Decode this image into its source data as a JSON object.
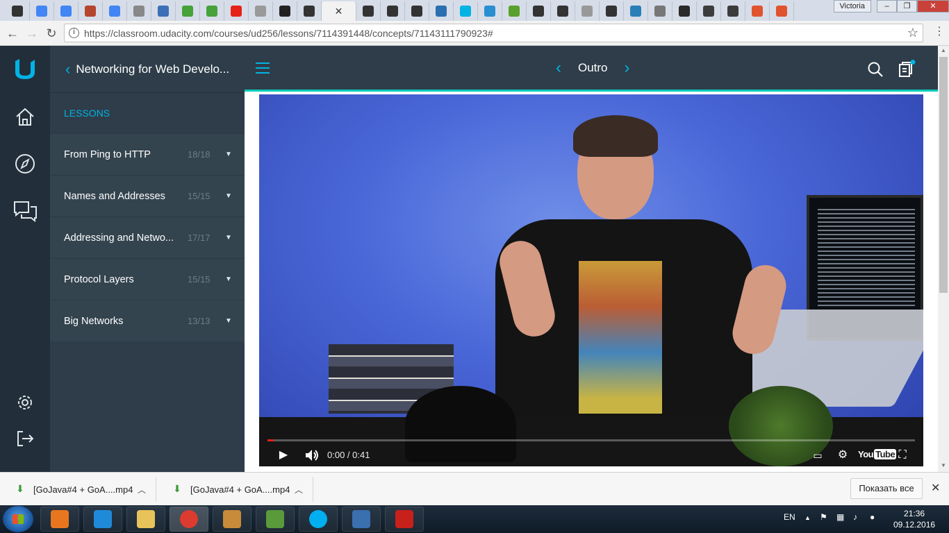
{
  "browser": {
    "tab_favicons": [
      {
        "icon": "github-icon",
        "color": "#333333"
      },
      {
        "icon": "google-icon",
        "color": "#4285f4"
      },
      {
        "icon": "google-icon",
        "color": "#4285f4"
      },
      {
        "icon": "paw-icon",
        "color": "#b5462d"
      },
      {
        "icon": "google-icon",
        "color": "#4285f4"
      },
      {
        "icon": "cart-icon",
        "color": "#888888"
      },
      {
        "icon": "chat-icon",
        "color": "#3b6fb6"
      },
      {
        "icon": "download-icon",
        "color": "#46a23b"
      },
      {
        "icon": "download-icon",
        "color": "#46a23b"
      },
      {
        "icon": "youtube-icon",
        "color": "#e62117"
      },
      {
        "icon": "document-icon",
        "color": "#999999"
      },
      {
        "icon": "ain-icon",
        "color": "#222222"
      },
      {
        "icon": "github-icon",
        "color": "#333333"
      }
    ],
    "tab_favicons_right": [
      {
        "icon": "terminal-icon",
        "color": "#333333"
      },
      {
        "icon": "github-icon",
        "color": "#333333"
      },
      {
        "icon": "github-icon",
        "color": "#333333"
      },
      {
        "icon": "image-icon",
        "color": "#2a6fb0"
      },
      {
        "icon": "udacity-icon",
        "color": "#02b3e4"
      },
      {
        "icon": "v-icon",
        "color": "#2a8fd0"
      },
      {
        "icon": "a-icon",
        "color": "#5aa02c"
      },
      {
        "icon": "github-icon",
        "color": "#333333"
      },
      {
        "icon": "github-icon",
        "color": "#333333"
      },
      {
        "icon": "document-icon",
        "color": "#999999"
      },
      {
        "icon": "github-icon",
        "color": "#333333"
      },
      {
        "icon": "cube-icon",
        "color": "#2a7fb6"
      },
      {
        "icon": "film-icon",
        "color": "#777777"
      },
      {
        "icon": "netping-icon",
        "color": "#2a2a2a"
      },
      {
        "icon": "avatar-icon",
        "color": "#3c3c3c"
      },
      {
        "icon": "avatar-icon",
        "color": "#3c3c3c"
      },
      {
        "icon": "git-icon",
        "color": "#e0532f"
      },
      {
        "icon": "git-icon",
        "color": "#e0532f"
      }
    ],
    "window_user": "Victoria",
    "url": "https://classroom.udacity.com/courses/ud256/lessons/7114391448/concepts/71143111790923#"
  },
  "app": {
    "course_title": "Networking for Web Develo...",
    "lessons_label": "LESSONS",
    "lessons": [
      {
        "name": "From Ping to HTTP",
        "count": "18/18"
      },
      {
        "name": "Names and Addresses",
        "count": "15/15"
      },
      {
        "name": "Addressing and Netwo...",
        "count": "17/17"
      },
      {
        "name": "Protocol Layers",
        "count": "15/15"
      },
      {
        "name": "Big Networks",
        "count": "13/13"
      }
    ],
    "concept_title": "Outro",
    "accent": "#02b3e4",
    "accent_bar": "#02ccba"
  },
  "video": {
    "time": "0:00 / 0:41",
    "progress": 0.01,
    "youtube_label": "You",
    "youtube_tube": "Tube"
  },
  "downloads": [
    {
      "filename": "[GoJava#4 + GoA....mp4"
    },
    {
      "filename": "[GoJava#4 + GoA....mp4"
    }
  ],
  "show_all": "Показать все",
  "taskbar": {
    "apps": [
      {
        "name": "media-player-icon",
        "color": "#e8761f"
      },
      {
        "name": "ie-icon",
        "color": "#1f8ad8"
      },
      {
        "name": "explorer-icon",
        "color": "#e8c35a"
      },
      {
        "name": "chrome-icon",
        "color": "#dc3b2f"
      },
      {
        "name": "paint-icon",
        "color": "#c78b3a"
      },
      {
        "name": "git-gui-icon",
        "color": "#5a9a3a"
      },
      {
        "name": "skype-icon",
        "color": "#00aff0"
      },
      {
        "name": "virtualbox-icon",
        "color": "#3a6fb0"
      },
      {
        "name": "acrobat-icon",
        "color": "#c8201a"
      }
    ],
    "lang": "EN",
    "time": "21:36",
    "date": "09.12.2016"
  }
}
